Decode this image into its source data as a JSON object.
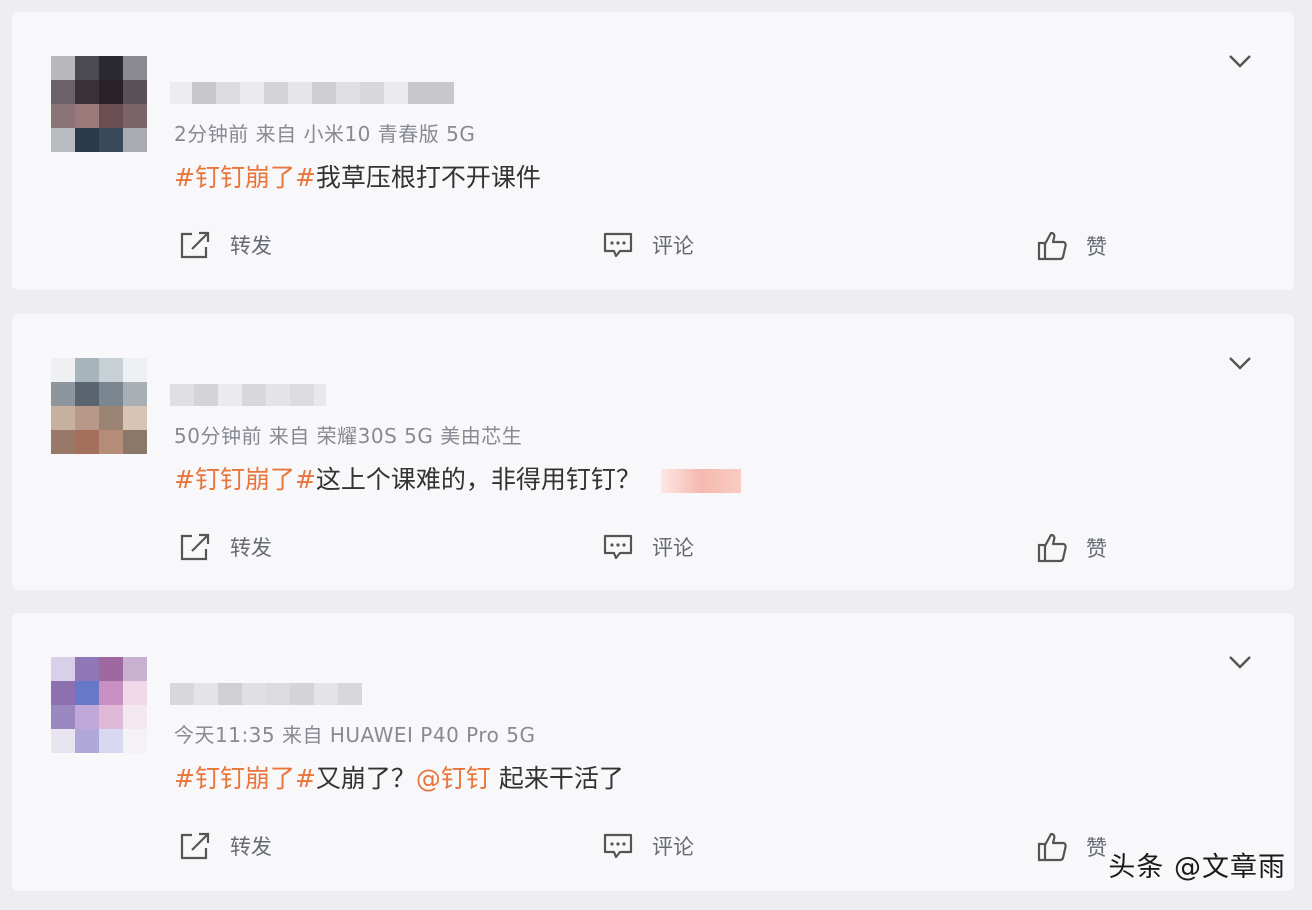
{
  "posts": [
    {
      "meta": "2分钟前  来自 小米10 青春版 5G",
      "tag": "#钉钉崩了#",
      "text": "我草压根打不开课件",
      "mention": "",
      "text_after": ""
    },
    {
      "meta": "50分钟前  来自 荣耀30S 5G 美由芯生",
      "tag": "#钉钉崩了#",
      "text": "这上个课难的，非得用钉钉？",
      "mention": "",
      "text_after": ""
    },
    {
      "meta": "今天11:35  来自 HUAWEI P40 Pro 5G",
      "tag": "#钉钉崩了#",
      "text": "又崩了？",
      "mention": "@钉钉",
      "text_after": " 起来干活了"
    }
  ],
  "actions": {
    "forward": "转发",
    "comment": "评论",
    "like": "赞"
  },
  "colors": {
    "accent": "#e8763c",
    "meta": "#888a93",
    "card_bg": "#f8f8fb",
    "page_bg": "#eeeef2"
  },
  "watermark": "头条 @文章雨"
}
